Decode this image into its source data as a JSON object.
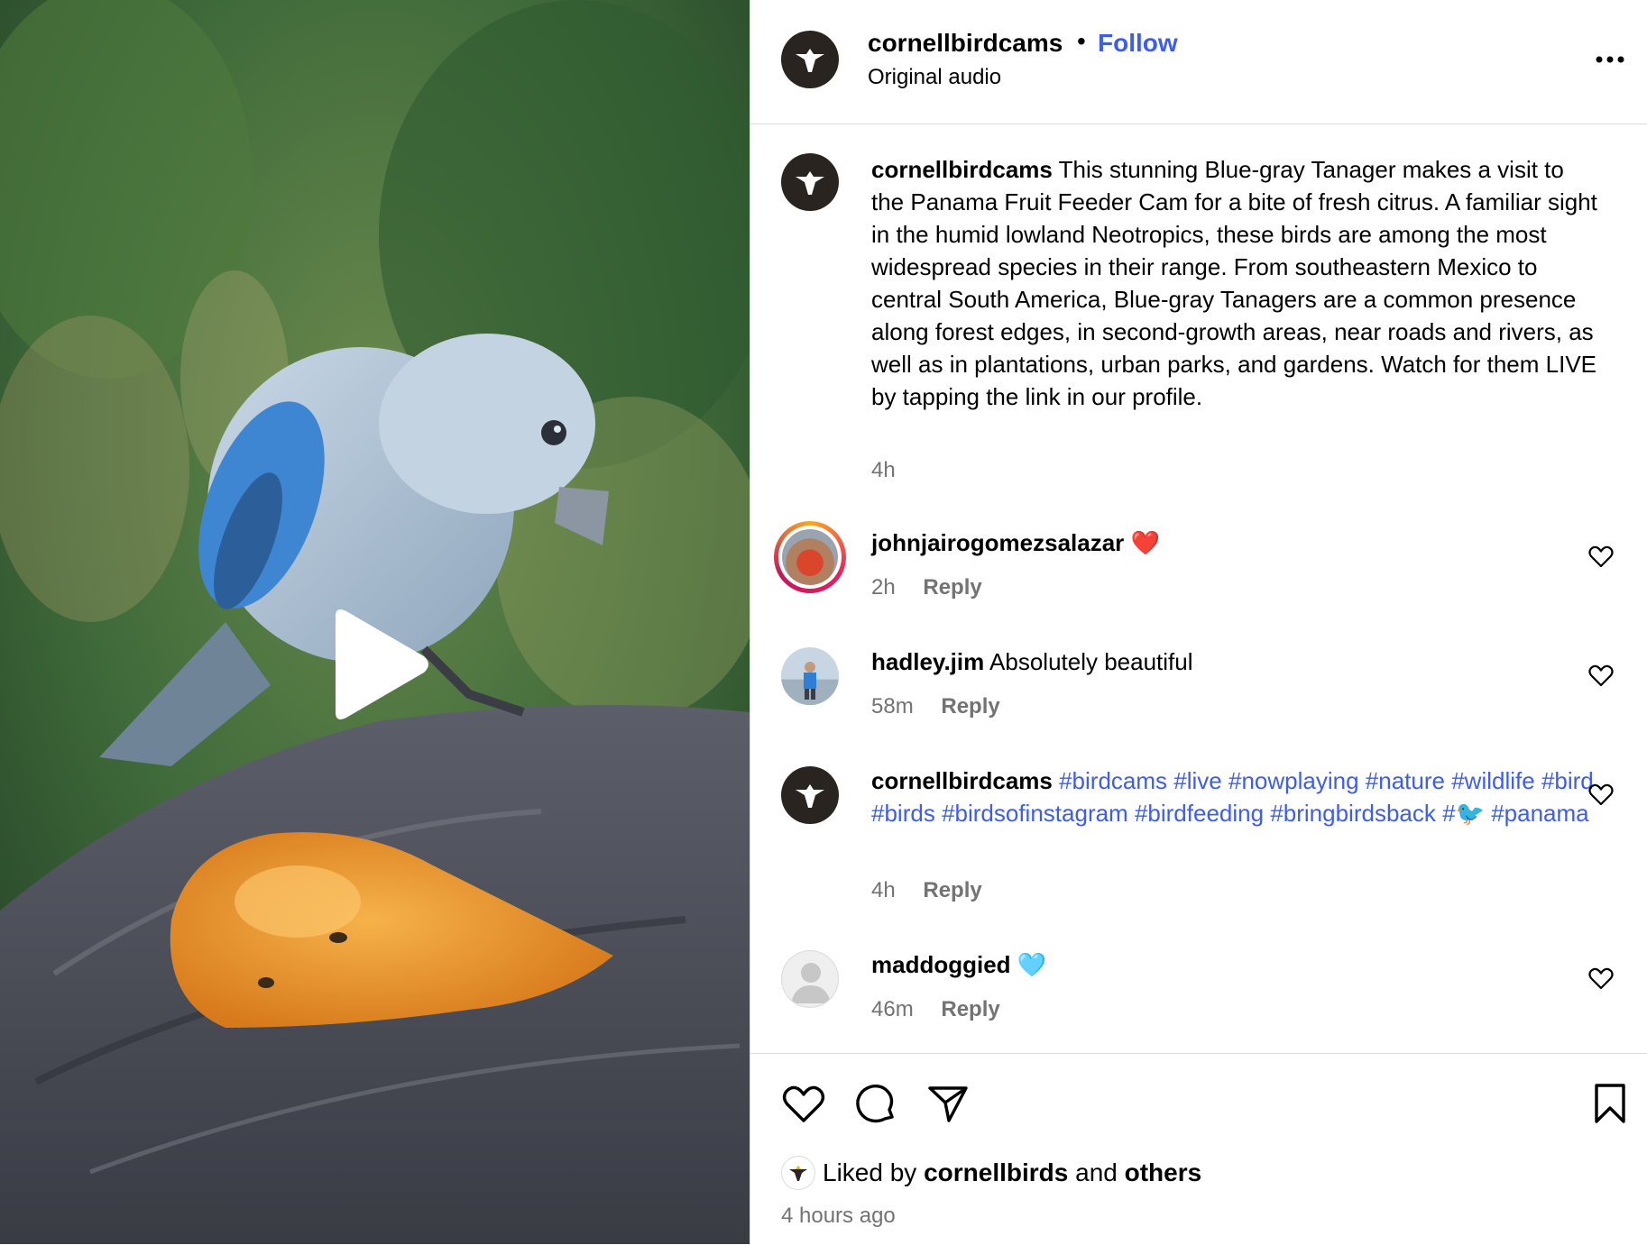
{
  "post": {
    "username": "cornellbirdcams",
    "separator": "•",
    "follow_label": "Follow",
    "audio": "Original audio"
  },
  "caption": {
    "username": "cornellbirdcams",
    "text": "This stunning Blue-gray Tanager makes a visit to the Panama Fruit Feeder Cam for a bite of fresh citrus. A familiar sight in the humid lowland Neotropics, these birds are among the most widespread species in their range. From southeastern Mexico to central South America, Blue-gray Tanagers are a common presence along forest edges, in second-growth areas, near roads and rivers, as well as in plantations, urban parks, and gardens. Watch for them LIVE by tapping the link in our profile.",
    "time": "4h"
  },
  "comments": [
    {
      "username": "johnjairogomezsalazar",
      "text": "❤️",
      "time": "2h",
      "reply": "Reply"
    },
    {
      "username": "hadley.jim",
      "text": "Absolutely beautiful",
      "time": "58m",
      "reply": "Reply"
    },
    {
      "username": "cornellbirdcams",
      "tags": [
        "#birdcams",
        "#live",
        "#nowplaying",
        "#nature",
        "#wildlife",
        "#bird",
        "#birds",
        "#birdsofinstagram",
        "#birdfeeding",
        "#bringbirdsback",
        "#🐦",
        "#panama"
      ],
      "time": "4h",
      "reply": "Reply"
    },
    {
      "username": "maddoggied",
      "text": "🩵",
      "time": "46m",
      "reply": "Reply"
    }
  ],
  "likes": {
    "prefix": "Liked by",
    "user": "cornellbirds",
    "and": "and",
    "others": "others"
  },
  "time_ago": "4 hours ago",
  "icons": {
    "more": "more-options-icon",
    "like": "heart-icon",
    "comment": "comment-icon",
    "share": "share-icon",
    "save": "bookmark-icon",
    "play": "play-icon"
  },
  "colors": {
    "link_blue": "#3d5cf0",
    "muted": "#737373",
    "border": "#dbdbdb"
  }
}
